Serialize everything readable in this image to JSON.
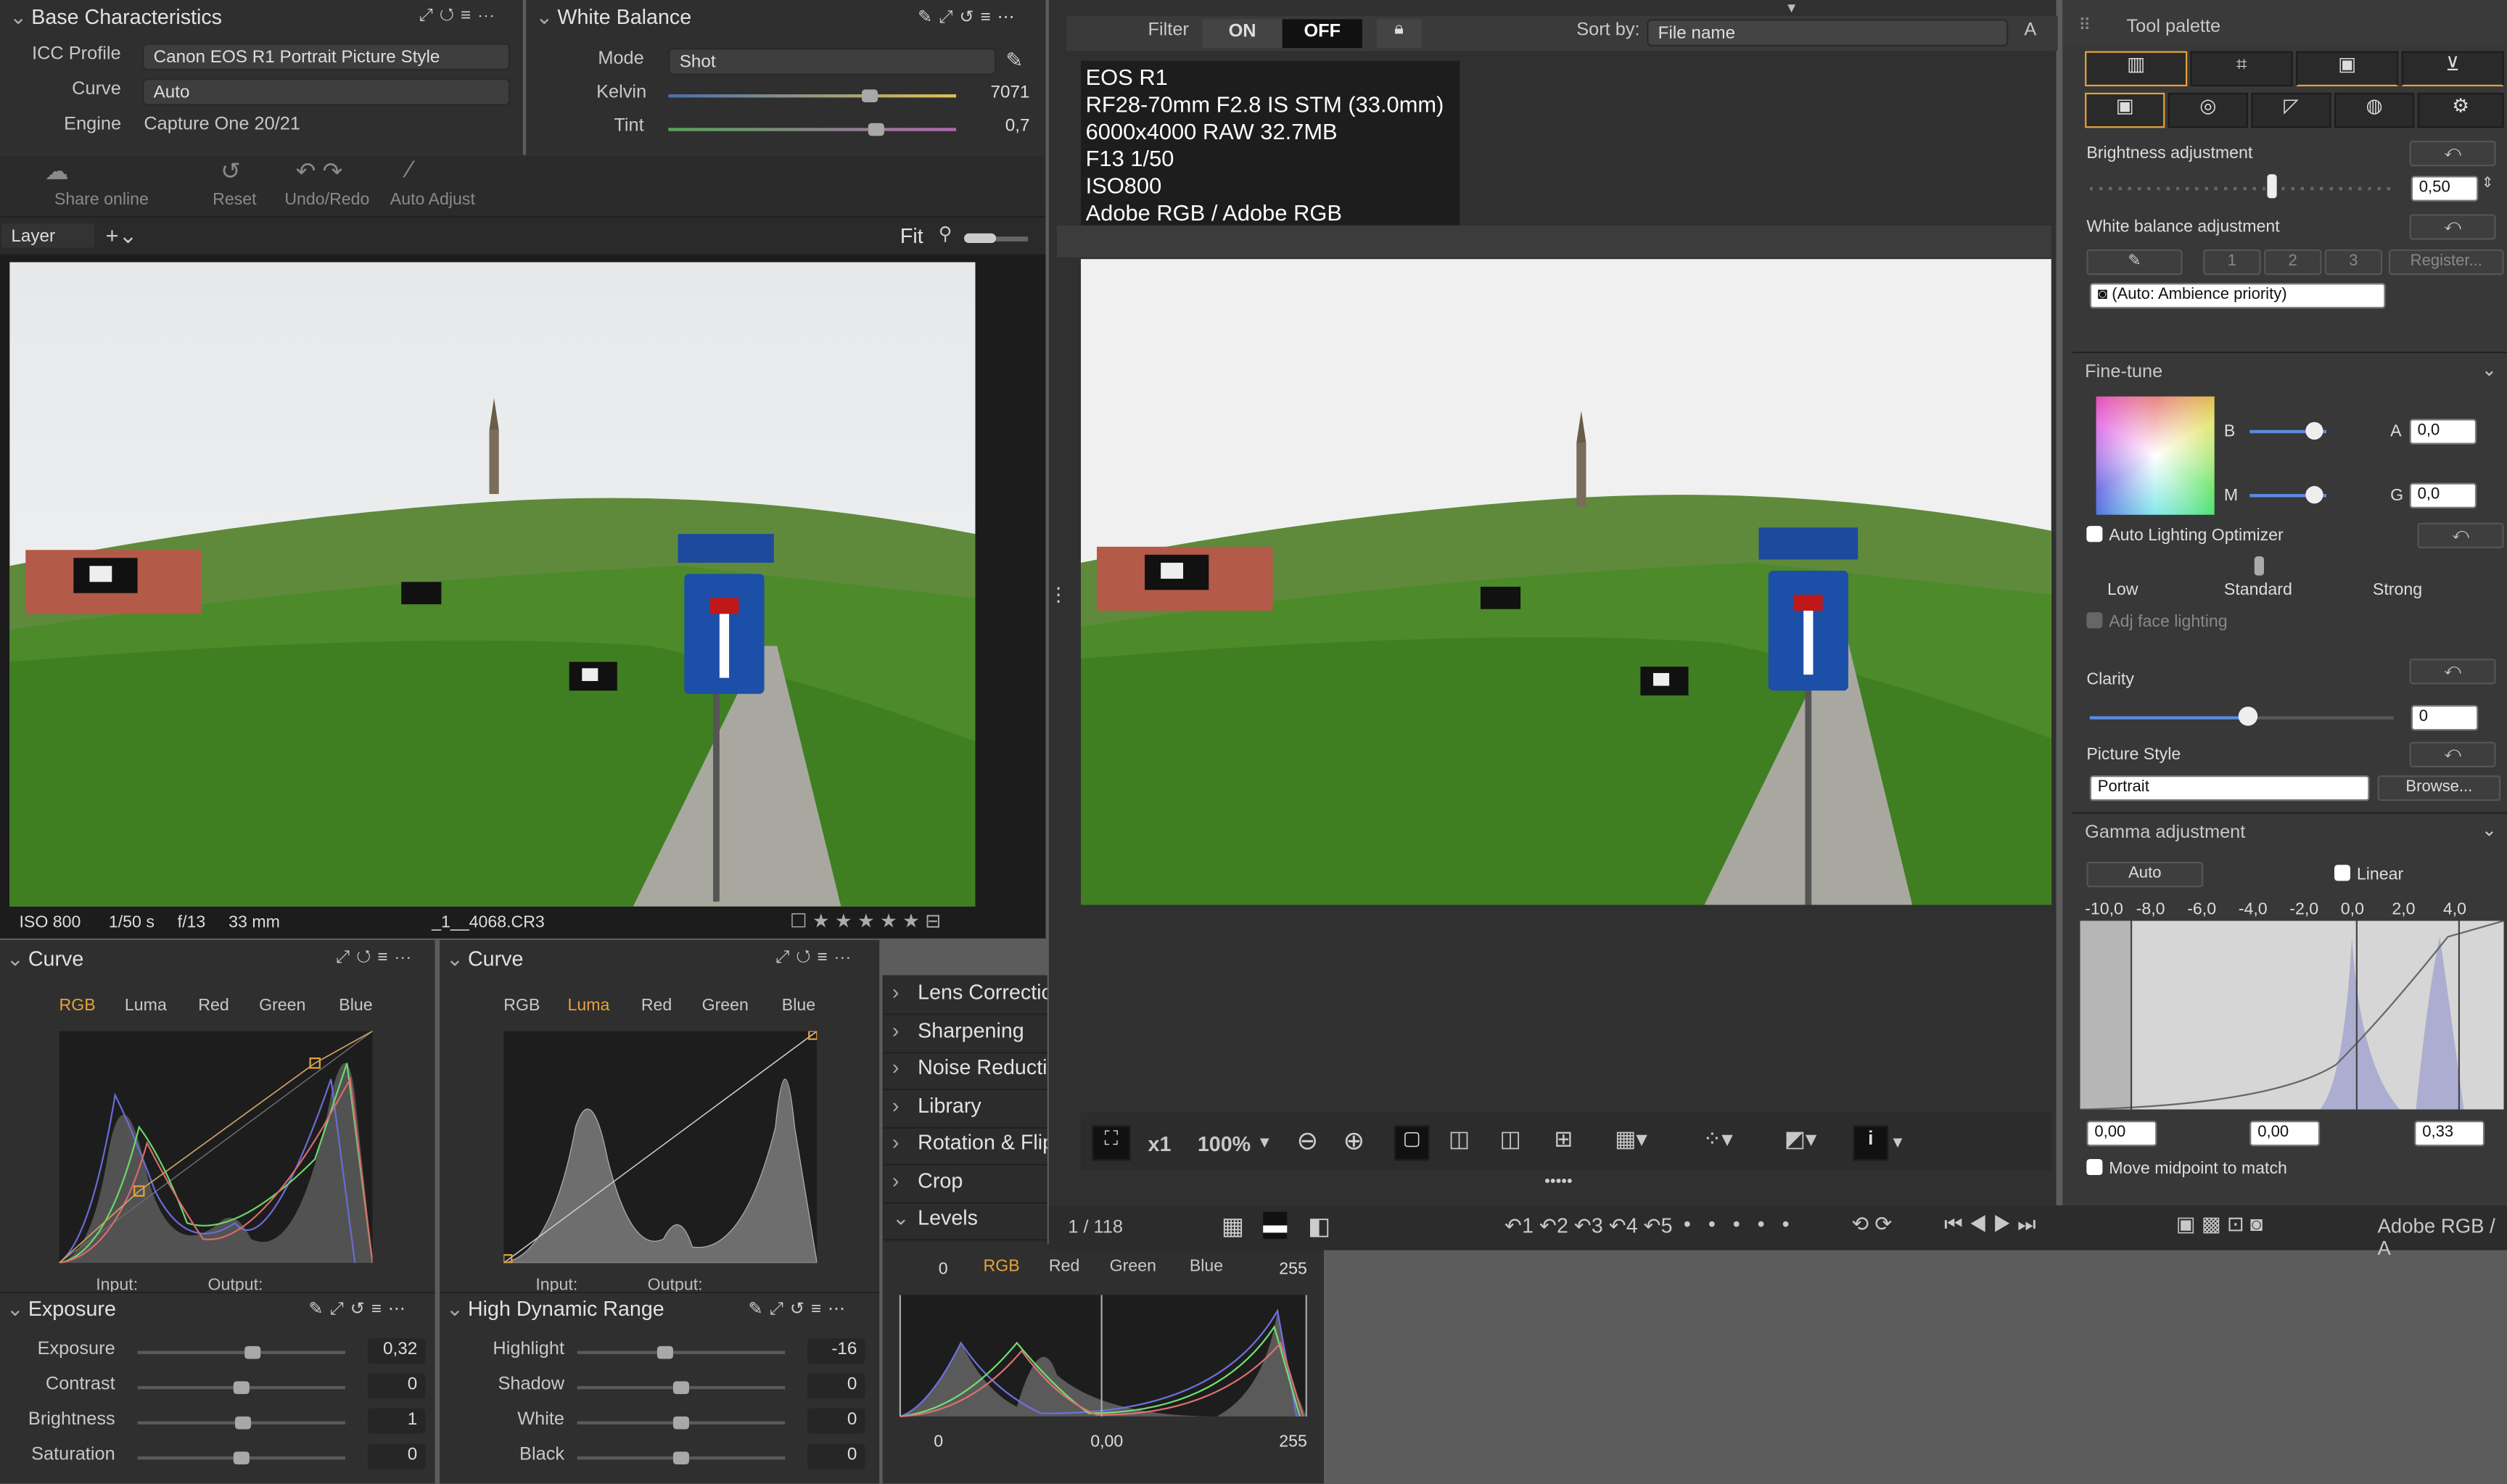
{
  "base": {
    "title": "Base Characteristics",
    "icc_label": "ICC Profile",
    "icc_value": "Canon EOS R1 Portrait Picture Style",
    "curve_label": "Curve",
    "curve_value": "Auto",
    "engine_label": "Engine",
    "engine_value": "Capture One 20/21"
  },
  "wb": {
    "title": "White Balance",
    "mode_label": "Mode",
    "mode_value": "Shot",
    "kelvin_label": "Kelvin",
    "kelvin_value": "7071",
    "tint_label": "Tint",
    "tint_value": "0,7",
    "kelvin_level": 0.7,
    "tint_level": 0.72
  },
  "toolbar": {
    "share": "Share online",
    "reset": "Reset",
    "undo": "Undo/Redo",
    "auto": "Auto Adjust"
  },
  "layer": {
    "label": "Layer",
    "fit": "Fit"
  },
  "photo_info": {
    "iso": "ISO 800",
    "shutter": "1/50 s",
    "aperture": "f/13",
    "focal": "33 mm",
    "file": "_1__4068.CR3"
  },
  "curve1": {
    "title": "Curve",
    "tabs": [
      "RGB",
      "Luma",
      "Red",
      "Green",
      "Blue"
    ],
    "active": 0,
    "input": "Input:",
    "output": "Output:"
  },
  "curve2": {
    "title": "Curve",
    "tabs": [
      "RGB",
      "Luma",
      "Red",
      "Green",
      "Blue"
    ],
    "active": 1,
    "input": "Input:",
    "output": "Output:"
  },
  "exposure": {
    "title": "Exposure",
    "rows": [
      {
        "label": "Exposure",
        "value": "0,32",
        "level": 0.55
      },
      {
        "label": "Contrast",
        "value": "0",
        "level": 0.5
      },
      {
        "label": "Brightness",
        "value": "1",
        "level": 0.51
      },
      {
        "label": "Saturation",
        "value": "0",
        "level": 0.5
      }
    ]
  },
  "hdr": {
    "title": "High Dynamic Range",
    "rows": [
      {
        "label": "Highlight",
        "value": "-16",
        "level": 0.42
      },
      {
        "label": "Shadow",
        "value": "0",
        "level": 0.5
      },
      {
        "label": "White",
        "value": "0",
        "level": 0.5
      },
      {
        "label": "Black",
        "value": "0",
        "level": 0.5
      }
    ]
  },
  "tools_list": [
    "Lens Correction",
    "Sharpening",
    "Noise Reduction",
    "Library",
    "Rotation & Flip",
    "Crop",
    "Levels"
  ],
  "levels": {
    "tabs": [
      "RGB",
      "Red",
      "Green",
      "Blue"
    ],
    "in_low": "0",
    "in_high": "255",
    "out_low": "0",
    "out_mid": "0,00",
    "out_high": "255"
  },
  "filter": {
    "label": "Filter",
    "on": "ON",
    "off": "OFF",
    "sort_label": "Sort by:",
    "sort_value": "File name",
    "sort_dir": "A"
  },
  "exif": {
    "lines": [
      "EOS R1",
      "RF28-70mm F2.8 IS STM (33.0mm)",
      "6000x4000 RAW 32.7MB",
      "F13 1/50",
      "ISO800",
      "Adobe RGB / Adobe RGB"
    ]
  },
  "viewer": {
    "zoom": "100%",
    "x1": "x1",
    "count": "1 / 118",
    "colorspace": "Adobe RGB / A"
  },
  "palette": {
    "title": "Tool palette",
    "brightness_label": "Brightness adjustment",
    "brightness_value": "0,50",
    "wb_label": "White balance adjustment",
    "wb_slots": [
      "1",
      "2",
      "3"
    ],
    "register": "Register...",
    "wb_select": "(Auto: Ambience priority)",
    "finetune": "Fine-tune",
    "b": "B",
    "a": "A",
    "a_value": "0,0",
    "m": "M",
    "g": "G",
    "g_value": "0,0",
    "alo": "Auto Lighting Optimizer",
    "low": "Low",
    "standard": "Standard",
    "strong": "Strong",
    "face": "Adj face lighting",
    "clarity": "Clarity",
    "clarity_value": "0",
    "ps_label": "Picture Style",
    "ps_value": "Portrait",
    "browse": "Browse...",
    "gamma": "Gamma adjustment",
    "auto": "Auto",
    "linear": "Linear",
    "scale": [
      "-10,0",
      "-8,0",
      "-6,0",
      "-4,0",
      "-2,0",
      "0,0",
      "2,0",
      "4,0"
    ],
    "g1": "0,00",
    "g2": "0,00",
    "g3": "0,33",
    "midpoint": "Move midpoint to match"
  },
  "colors": {
    "accent": "#e8a23a",
    "panel": "#2f2f2f",
    "dark": "#1e1e1e"
  }
}
